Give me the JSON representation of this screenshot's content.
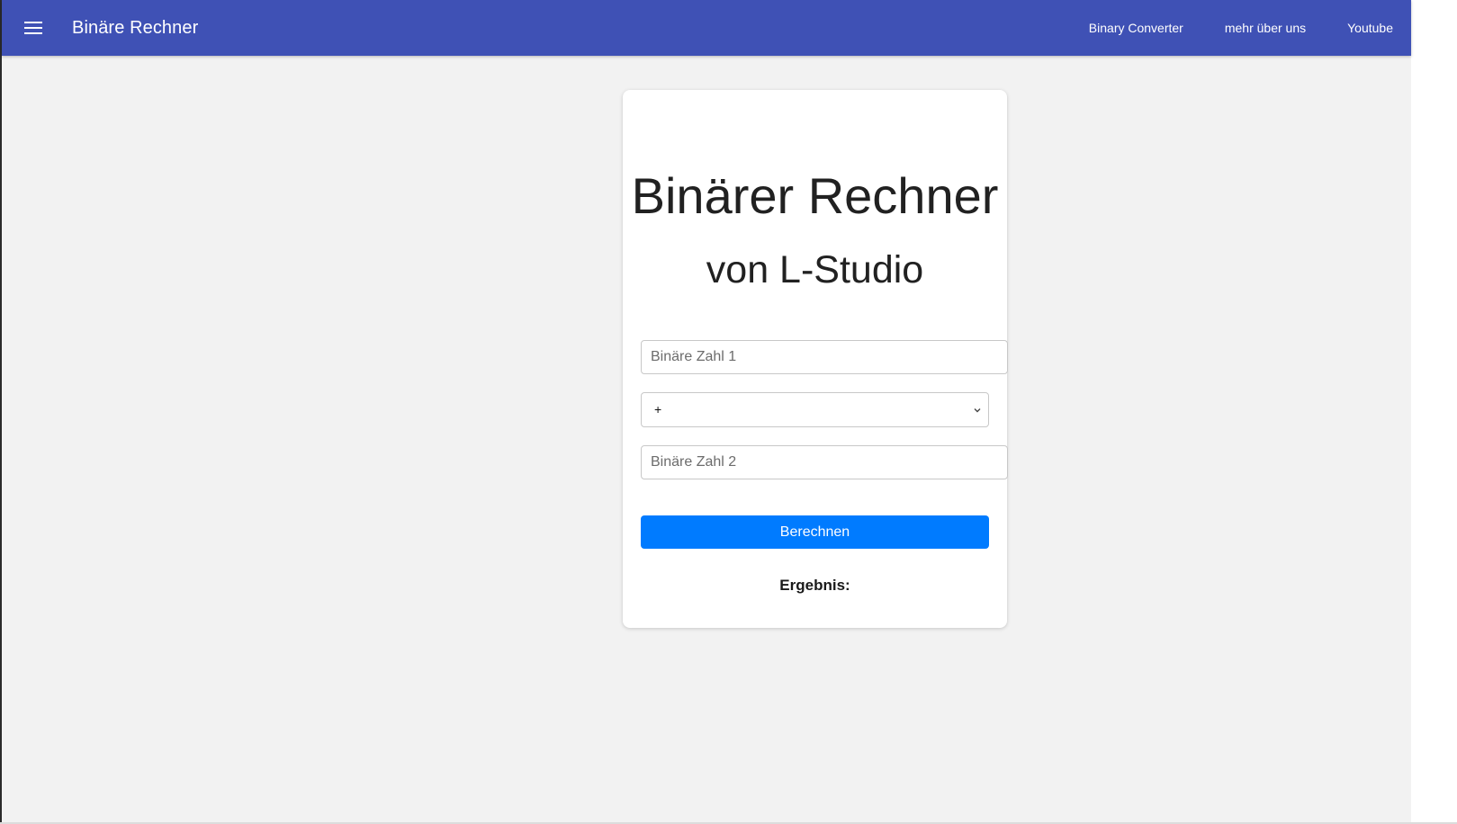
{
  "header": {
    "menu_icon": "hamburger-menu-icon",
    "brand": "Binäre Rechner",
    "nav": [
      {
        "label": "Binary Converter"
      },
      {
        "label": "mehr über uns"
      },
      {
        "label": "Youtube"
      }
    ],
    "background_color": "#3f51b5"
  },
  "card": {
    "title": "Binärer Rechner",
    "subtitle": "von L-Studio",
    "input1_placeholder": "Binäre Zahl 1",
    "input1_value": "",
    "operator_selected": "+",
    "input2_placeholder": "Binäre Zahl 2",
    "input2_value": "",
    "button_label": "Berechnen",
    "button_color": "#007bff",
    "result_label": "Ergebnis:"
  }
}
